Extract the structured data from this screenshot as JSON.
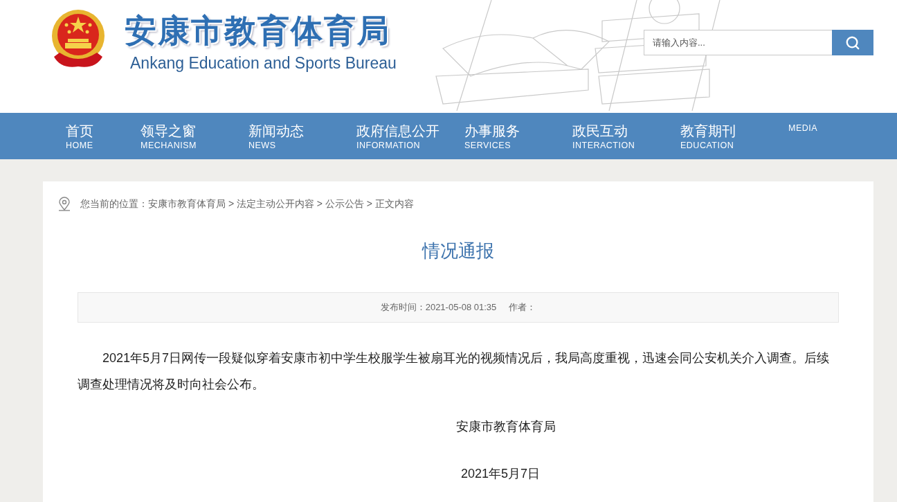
{
  "header": {
    "title": "安康市教育体育局",
    "subtitle": "Ankang Education and Sports Bureau",
    "search": {
      "placeholder": "请输入内容..."
    }
  },
  "nav": [
    {
      "zh": "首页",
      "en": "HOME"
    },
    {
      "zh": "领导之窗",
      "en": "MECHANISM"
    },
    {
      "zh": "新闻动态",
      "en": "NEWS"
    },
    {
      "zh": "政府信息公开",
      "en": "INFORMATION"
    },
    {
      "zh": "办事服务",
      "en": "SERVICES"
    },
    {
      "zh": "政民互动",
      "en": "INTERACTION"
    },
    {
      "zh": "教育期刊",
      "en": "EDUCATION"
    },
    {
      "en": "MEDIA"
    }
  ],
  "breadcrumb": "您当前的位置：安康市教育体育局 > 法定主动公开内容 > 公示公告 > 正文内容",
  "article": {
    "title": "情况通报",
    "published": "发布时间：2021-05-08 01:35",
    "author": "作者：",
    "body": "2021年5月7日网传一段疑似穿着安康市初中学生校服学生被扇耳光的视频情况后，我局高度重视，迅速会同公安机关介入调查。后续调查处理情况将及时向社会公布。",
    "signature": "安康市教育体育局",
    "date": "2021年5月7日"
  }
}
